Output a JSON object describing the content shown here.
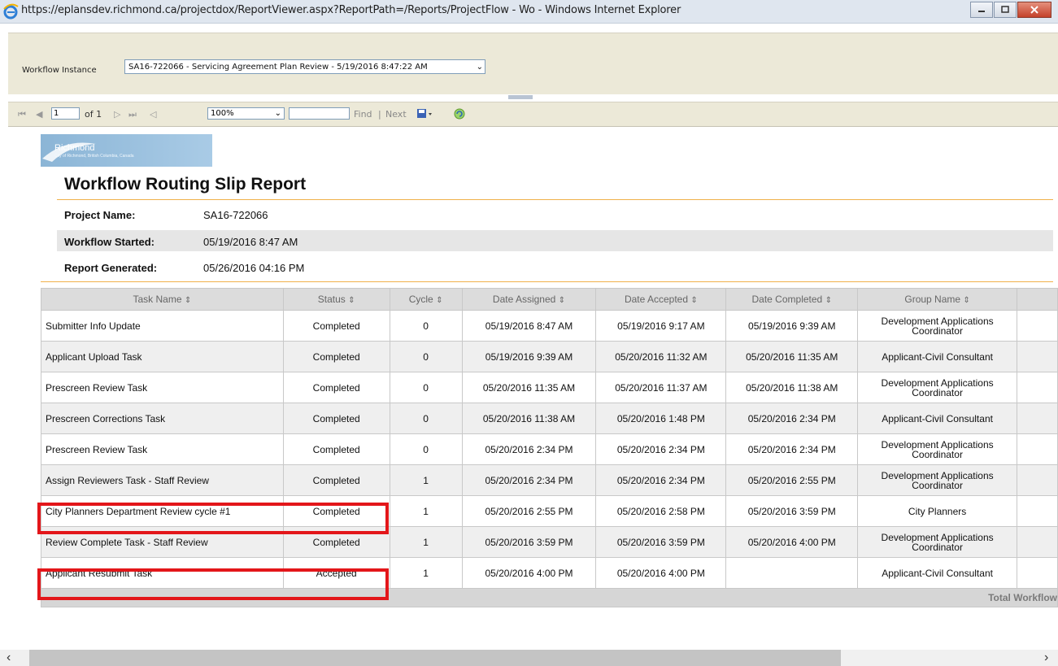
{
  "window": {
    "title": "https://eplansdev.richmond.ca/projectdox/ReportViewer.aspx?ReportPath=/Reports/ProjectFlow - Wo - Windows Internet Explorer"
  },
  "params": {
    "workflow_label": "Workflow Instance",
    "workflow_value": "SA16-722066 - Servicing Agreement Plan Review - 5/19/2016 8:47:22 AM"
  },
  "toolbar": {
    "page_value": "1",
    "page_of": "of 1",
    "zoom": "100%",
    "find_label": "Find",
    "separator": "|",
    "next_label": "Next"
  },
  "report": {
    "logo_name": "Richmond",
    "logo_sub": "City of Richmond, British Columbia, Canada",
    "title": "Workflow Routing Slip Report",
    "info": [
      {
        "key": "Project Name:",
        "value": "SA16-722066"
      },
      {
        "key": "Workflow Started:",
        "value": "05/19/2016  8:47 AM"
      },
      {
        "key": "Report Generated:",
        "value": "05/26/2016 04:16 PM"
      }
    ],
    "sort_glyph": "⇕",
    "columns": [
      "Task Name",
      "Status",
      "Cycle",
      "Date Assigned",
      "Date Accepted",
      "Date Completed",
      "Group Name"
    ],
    "rows": [
      [
        "Submitter Info Update",
        "Completed",
        "0",
        "05/19/2016 8:47 AM",
        "05/19/2016 9:17 AM",
        "05/19/2016 9:39 AM",
        "Development Applications Coordinator"
      ],
      [
        "Applicant Upload Task",
        "Completed",
        "0",
        "05/19/2016 9:39 AM",
        "05/20/2016 11:32 AM",
        "05/20/2016 11:35 AM",
        "Applicant-Civil Consultant"
      ],
      [
        "Prescreen Review Task",
        "Completed",
        "0",
        "05/20/2016 11:35 AM",
        "05/20/2016 11:37 AM",
        "05/20/2016 11:38 AM",
        "Development Applications Coordinator"
      ],
      [
        "Prescreen Corrections Task",
        "Completed",
        "0",
        "05/20/2016 11:38 AM",
        "05/20/2016  1:48 PM",
        "05/20/2016  2:34 PM",
        "Applicant-Civil Consultant"
      ],
      [
        "Prescreen Review Task",
        "Completed",
        "0",
        "05/20/2016  2:34 PM",
        "05/20/2016  2:34 PM",
        "05/20/2016  2:34 PM",
        "Development Applications Coordinator"
      ],
      [
        "Assign Reviewers Task - Staff Review",
        "Completed",
        "1",
        "05/20/2016  2:34 PM",
        "05/20/2016  2:34 PM",
        "05/20/2016  2:55 PM",
        "Development Applications Coordinator"
      ],
      [
        "City Planners Department Review cycle #1",
        "Completed",
        "1",
        "05/20/2016  2:55 PM",
        "05/20/2016  2:58 PM",
        "05/20/2016  3:59 PM",
        "City Planners"
      ],
      [
        "Review Complete Task - Staff Review",
        "Completed",
        "1",
        "05/20/2016  3:59 PM",
        "05/20/2016  3:59 PM",
        "05/20/2016  4:00 PM",
        "Development Applications Coordinator"
      ],
      [
        "Applicant Resubmit Task",
        "Accepted",
        "1",
        "05/20/2016  4:00 PM",
        "05/20/2016  4:00 PM",
        "",
        "Applicant-Civil Consultant"
      ]
    ],
    "footer": "Total Workflow"
  },
  "colors": {
    "highlight": "#e3161a",
    "accent_line": "#f0b14a"
  }
}
